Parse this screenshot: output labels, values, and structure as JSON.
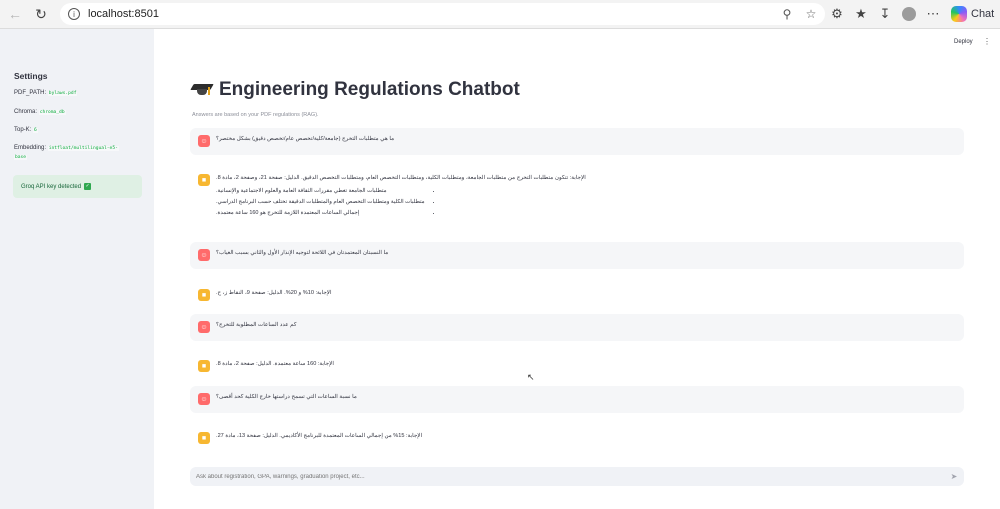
{
  "browser": {
    "url": "localhost:8501",
    "chat_label": "Chat"
  },
  "sidebar": {
    "title": "Settings",
    "pdf_path_label": "PDF_PATH:",
    "pdf_path_value": "bylaws.pdf",
    "chroma_label": "Chroma:",
    "chroma_value": "chroma_db",
    "topk_label": "Top-K:",
    "topk_value": "6",
    "embedding_label": "Embedding:",
    "embedding_value_line1": "intfloat/multilingual-e5-",
    "embedding_value_line2": "base",
    "alert_text": "Groq API key detected"
  },
  "header": {
    "deploy_label": "Deploy",
    "title": "Engineering Regulations Chatbot",
    "caption": "Answers are based on your PDF regulations (RAG)."
  },
  "messages": [
    {
      "role": "user",
      "text": "ما هي متطلبات التخرج (جامعة/كلية/تخصص عام/تخصص دقيق) بشكل مختصر؟"
    },
    {
      "role": "assistant",
      "text": "الإجابة: تتكون متطلبات التخرج من متطلبات الجامعة، ومتطلبات الكلية، ومتطلبات التخصص العام، ومتطلبات التخصص الدقيق. الدليل: صفحة 21، وصفحة 2، مادة 8.",
      "bullets": [
        "متطلبات الجامعة تغطي مقررات الثقافة العامة والعلوم الاجتماعية والإنسانية.",
        "متطلبات الكلية ومتطلبات التخصص العام والمتطلبات الدقيقة تختلف حسب البرنامج الدراسي.",
        "إجمالي الساعات المعتمدة اللازمة للتخرج هو 160 ساعة معتمدة."
      ]
    },
    {
      "role": "user",
      "text": "ما النسبتان المعتمدتان في اللائحة لتوجيه الإنذار الأول والثاني بسبب الغياب؟"
    },
    {
      "role": "assistant",
      "text": "الإجابة: 10% و 20%. الدليل: صفحة 9، النقاط ز، ح."
    },
    {
      "role": "user",
      "text": "كم عدد الساعات المطلوبة للتخرج؟"
    },
    {
      "role": "assistant",
      "text": "الإجابة: 160 ساعة معتمدة. الدليل: صفحة 2، مادة 8."
    },
    {
      "role": "user",
      "text": "ما نسبة الساعات التي تسمح دراستها خارج الكلية كحد أقصى؟"
    },
    {
      "role": "assistant",
      "text": "الإجابة: 15% من إجمالي الساعات المعتمدة للبرنامج الأكاديمي. الدليل: صفحة 13، مادة 27."
    }
  ],
  "chat_input": {
    "placeholder": "Ask about registration, GPA, warnings, graduation project, etc..."
  },
  "colors": {
    "user_avatar": "#ff6b6b",
    "assistant_avatar": "#f7b731",
    "sidebar_bg": "#f0f2f6",
    "alert_bg": "#dff0e4"
  }
}
